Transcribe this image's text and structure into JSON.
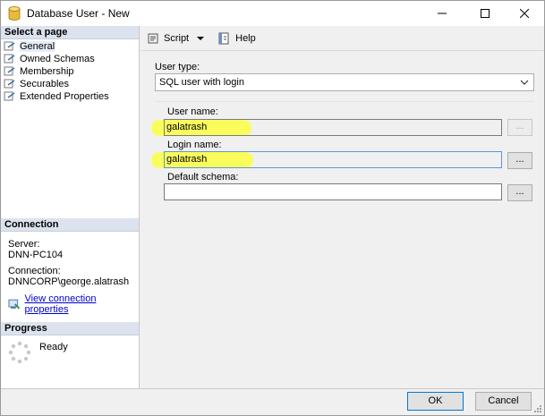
{
  "window": {
    "title": "Database User - New"
  },
  "left_panel": {
    "select_page_heading": "Select a page",
    "pages": [
      {
        "label": "General",
        "selected": true
      },
      {
        "label": "Owned Schemas",
        "selected": false
      },
      {
        "label": "Membership",
        "selected": false
      },
      {
        "label": "Securables",
        "selected": false
      },
      {
        "label": "Extended Properties",
        "selected": false
      }
    ],
    "connection_heading": "Connection",
    "server_label": "Server:",
    "server_value": "DNN-PC104",
    "connection_label": "Connection:",
    "connection_value": "DNNCORP\\george.alatrash",
    "view_connection_link": "View connection properties",
    "progress_heading": "Progress",
    "progress_status": "Ready"
  },
  "toolbar": {
    "script_label": "Script",
    "help_label": "Help"
  },
  "form": {
    "user_type_label": "User type:",
    "user_type_value": "SQL user with login",
    "user_name_label": "User name:",
    "user_name_value": "galatrash",
    "login_name_label": "Login name:",
    "login_name_value": "galatrash",
    "default_schema_label": "Default schema:",
    "default_schema_value": "",
    "browse_label": "..."
  },
  "buttons": {
    "ok": "OK",
    "cancel": "Cancel"
  },
  "colors": {
    "highlight": "#fafc5c",
    "section_header": "#dce3ee",
    "link": "#0000cc",
    "focus_border": "#5b97d8"
  }
}
